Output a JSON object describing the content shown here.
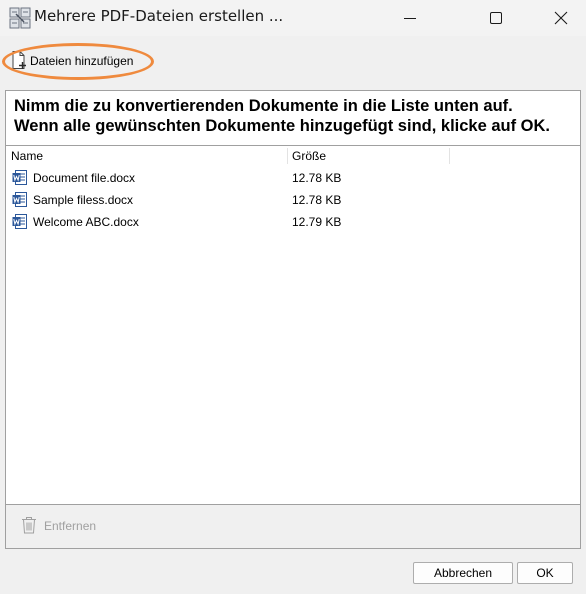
{
  "window": {
    "title": "Mehrere PDF-Dateien erstellen ..."
  },
  "toolbar": {
    "add_files_label": "Dateien hinzufügen",
    "add_files_icon": "file-add-icon",
    "highlight_color": "#ef8a3e"
  },
  "instructions": {
    "line1": "Nimm die zu konvertierenden Dokumente in die Liste unten auf.",
    "line2": "Wenn alle gewünschten Dokumente hinzugefügt sind, klicke auf OK."
  },
  "file_list": {
    "columns": {
      "name": "Name",
      "size": "Größe"
    },
    "rows": [
      {
        "name": "Document file.docx",
        "size": "12.78 KB",
        "icon": "word-document-icon"
      },
      {
        "name": "Sample filess.docx",
        "size": "12.78 KB",
        "icon": "word-document-icon"
      },
      {
        "name": "Welcome ABC.docx",
        "size": "12.79 KB",
        "icon": "word-document-icon"
      }
    ]
  },
  "remove": {
    "label": "Entfernen",
    "icon": "trash-icon"
  },
  "footer": {
    "cancel_label": "Abbrechen",
    "ok_label": "OK"
  }
}
